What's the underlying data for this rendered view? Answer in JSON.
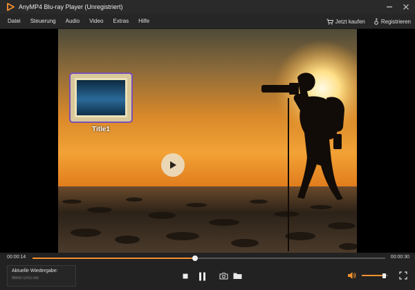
{
  "window": {
    "title": "AnyMP4 Blu-ray Player (Unregistriert)",
    "accent": "#f5912e"
  },
  "menu": {
    "items": [
      "Datei",
      "Steuerung",
      "Audio",
      "Video",
      "Extras",
      "Hilfe"
    ],
    "buy_label": "Jetzt kaufen",
    "register_label": "Registrieren"
  },
  "dvd_menu": {
    "title_label": "Title1"
  },
  "playback": {
    "elapsed": "00:00:14",
    "total": "00:00:30",
    "progress": 0.46,
    "volume": 0.85
  },
  "now_playing": {
    "label": "Aktuelle Wiedergabe:",
    "value": "Menu DVD.iso"
  },
  "icons": {
    "logo": "play-triangle-icon",
    "minimize": "minimize-icon",
    "close": "close-icon",
    "cart": "cart-icon",
    "key": "key-icon",
    "stop": "stop-icon",
    "pause": "pause-icon",
    "snapshot": "camera-icon",
    "folder": "folder-icon",
    "volume": "speaker-icon",
    "fullscreen": "fullscreen-icon"
  }
}
